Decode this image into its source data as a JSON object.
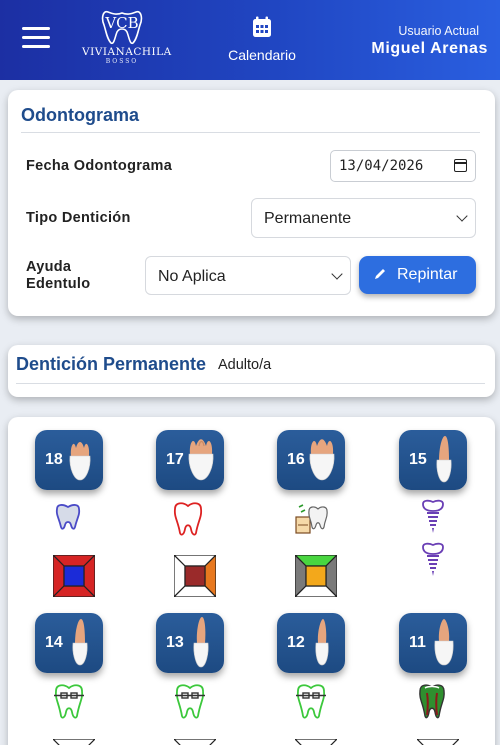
{
  "header": {
    "brand_name": "VIVIANACHILA",
    "brand_sub": "BOSSO",
    "calendar_label": "Calendario",
    "user_caption": "Usuario Actual",
    "user_name": "Miguel Arenas",
    "bg_color": "#2046c2"
  },
  "odontograma": {
    "title": "Odontograma",
    "fecha_label": "Fecha Odontograma",
    "fecha_value": "13/04/2026",
    "tipo_label": "Tipo Dentición",
    "tipo_value": "Permanente",
    "ayuda_label_1": "Ayuda",
    "ayuda_label_2": "Edentulo",
    "ayuda_value": "No Aplica",
    "repintar_label": "Repintar"
  },
  "denticion": {
    "title": "Dentición Permanente",
    "subtitle": "Adulto/a"
  },
  "teeth": [
    {
      "number": "18",
      "marker": "filled-molar-icon",
      "surfaces": {
        "top": "#d62424",
        "left": "#d62424",
        "center": "#1b2bd8",
        "right": "#d62424",
        "bottom": "#d62424"
      }
    },
    {
      "number": "17",
      "marker": "outline-molar-red-icon",
      "surfaces": {
        "top": "#ffffff",
        "left": "#ffffff",
        "center": "#9a2a2a",
        "right": "#e8781e",
        "bottom": "#ffffff"
      }
    },
    {
      "number": "16",
      "marker": "extraction-indicated-icon",
      "surfaces": {
        "top": "#49d640",
        "left": "#7a7a7a",
        "center": "#f3a81b",
        "right": "#7a7a7a",
        "bottom": "#ffffff"
      }
    },
    {
      "number": "15",
      "marker": "implant-icon",
      "surfaces": null
    },
    {
      "number": "14",
      "marker": "braces-icon",
      "surfaces": null
    },
    {
      "number": "13",
      "marker": "braces-icon",
      "surfaces": null
    },
    {
      "number": "12",
      "marker": "braces-icon",
      "surfaces": null
    },
    {
      "number": "11",
      "marker": "root-canal-icon",
      "surfaces": null
    }
  ]
}
